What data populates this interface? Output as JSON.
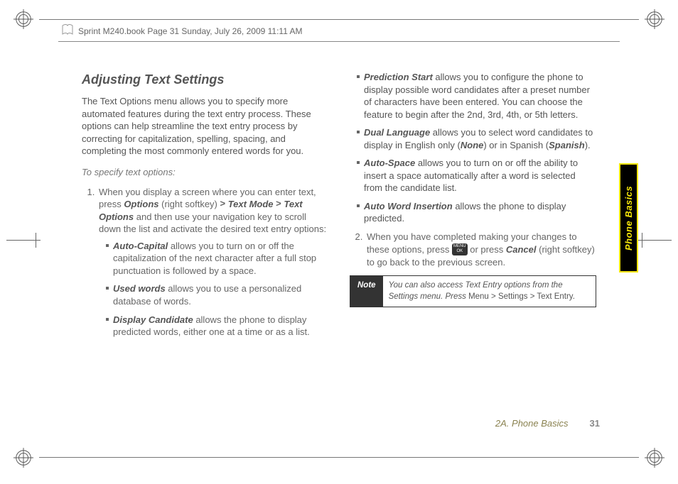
{
  "header": {
    "book_info": "Sprint M240.book  Page 31  Sunday, July 26, 2009  11:11 AM"
  },
  "side_tab": "Phone Basics",
  "footer": {
    "section": "2A. Phone Basics",
    "page_number": "31"
  },
  "content": {
    "title": "Adjusting Text Settings",
    "intro": "The Text Options menu allows you to specify more automated features during the text entry process. These options can help streamline the text entry process by correcting for capitalization, spelling, spacing, and completing the most commonly entered words for you.",
    "subhead": "To specify text options:",
    "step1_prefix": "When you display a screen where you can enter text, press ",
    "step1_options": "Options",
    "step1_rsoft": " (right softkey) ",
    "step1_tm": "Text Mode",
    "step1_to": "Text Options",
    "step1_suffix": " and then use your navigation key to scroll down the list and activate the desired text entry options:",
    "bullets_left": [
      {
        "term": "Auto-Capital",
        "desc": " allows you to turn on or off the capitalization of the next character after a full stop punctuation is followed by a space."
      },
      {
        "term": "Used words",
        "desc": " allows you to use a personalized database of words."
      },
      {
        "term": "Display Candidate",
        "desc": " allows the phone to display predicted words, either one at a time or as a list."
      }
    ],
    "bullets_right": [
      {
        "term": "Prediction Start",
        "desc": " allows you to configure the phone to display possible word candidates after a preset number of characters have been entered. You can choose the feature to begin after the 2nd, 3rd, 4th, or 5th letters."
      },
      {
        "term": "Dual Language",
        "desc_pre": " allows you to select word candidates to display in English only (",
        "none": "None",
        "mid": ") or in Spanish (",
        "spanish": "Spanish",
        "desc_post": ")."
      },
      {
        "term": "Auto-Space",
        "desc": " allows you to turn on or off the ability to insert a space automatically after a word is selected from the candidate list."
      },
      {
        "term": "Auto Word Insertion",
        "desc": " allows the phone to display predicted."
      }
    ],
    "step2_prefix": "When you have completed making your changes to these options, press ",
    "step2_or": " or press ",
    "step2_cancel": "Cancel",
    "step2_suffix": " (right softkey) to go back to the previous screen.",
    "note_label": "Note",
    "note_body_pre": "You can also access Text Entry options from the Settings menu. Press ",
    "note_menu": "Menu",
    "note_settings": "Settings",
    "note_textentry": "Text Entry",
    "note_period": "."
  }
}
